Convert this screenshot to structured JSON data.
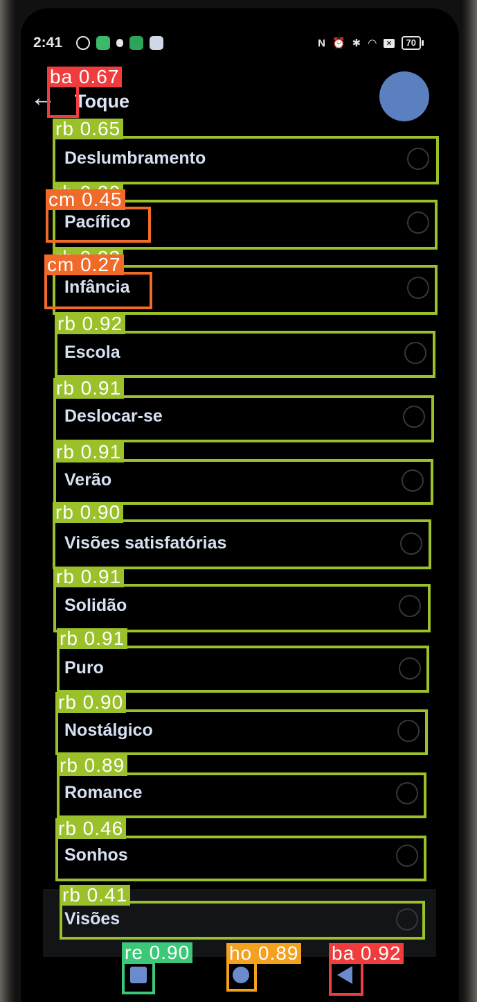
{
  "status_bar": {
    "time": "2:41",
    "battery": "70",
    "left_icons": [
      "settings-icon",
      "grid-app-icon",
      "bug-icon",
      "phone-app-icon",
      "message-icon"
    ],
    "right_icons": [
      "nfc-icon",
      "alarm-icon",
      "bluetooth-icon",
      "wifi-icon",
      "close-box-icon",
      "battery-icon"
    ]
  },
  "header": {
    "title": "Toque",
    "back_icon": "arrow-left-icon"
  },
  "list": {
    "items": [
      {
        "label": "Deslumbramento"
      },
      {
        "label": "Pacífico"
      },
      {
        "label": "Infância"
      },
      {
        "label": "Escola"
      },
      {
        "label": "Deslocar-se"
      },
      {
        "label": "Verão"
      },
      {
        "label": "Visões satisfatórias"
      },
      {
        "label": "Solidão"
      },
      {
        "label": "Puro"
      },
      {
        "label": "Nostálgico"
      },
      {
        "label": "Romance"
      },
      {
        "label": "Sonhos"
      },
      {
        "label": "Visões"
      }
    ]
  },
  "nav_bar": {
    "recents_icon": "square-recents-icon",
    "home_icon": "circle-home-icon",
    "back_icon": "triangle-back-icon"
  },
  "detections": [
    {
      "label": "ba 0.67",
      "color": "#f03c3c"
    },
    {
      "label": "rb 0.65",
      "color": "#9ac02a"
    },
    {
      "label": "rb 0.90",
      "color": "#9ac02a"
    },
    {
      "label": "cm 0.45",
      "color": "#f06a2a"
    },
    {
      "label": "rb 0.93",
      "color": "#9ac02a"
    },
    {
      "label": "cm 0.27",
      "color": "#f06a2a"
    },
    {
      "label": "rb 0.92",
      "color": "#9ac02a"
    },
    {
      "label": "rb 0.91",
      "color": "#9ac02a"
    },
    {
      "label": "rb 0.91",
      "color": "#9ac02a"
    },
    {
      "label": "rb 0.90",
      "color": "#9ac02a"
    },
    {
      "label": "rb 0.91",
      "color": "#9ac02a"
    },
    {
      "label": "rb 0.91",
      "color": "#9ac02a"
    },
    {
      "label": "rb 0.90",
      "color": "#9ac02a"
    },
    {
      "label": "rb 0.89",
      "color": "#9ac02a"
    },
    {
      "label": "rb 0.46",
      "color": "#9ac02a"
    },
    {
      "label": "rb 0.41",
      "color": "#9ac02a"
    },
    {
      "label": "re 0.90",
      "color": "#3cc878"
    },
    {
      "label": "ho 0.89",
      "color": "#f4a020"
    },
    {
      "label": "ba 0.92",
      "color": "#f03c3c"
    }
  ]
}
